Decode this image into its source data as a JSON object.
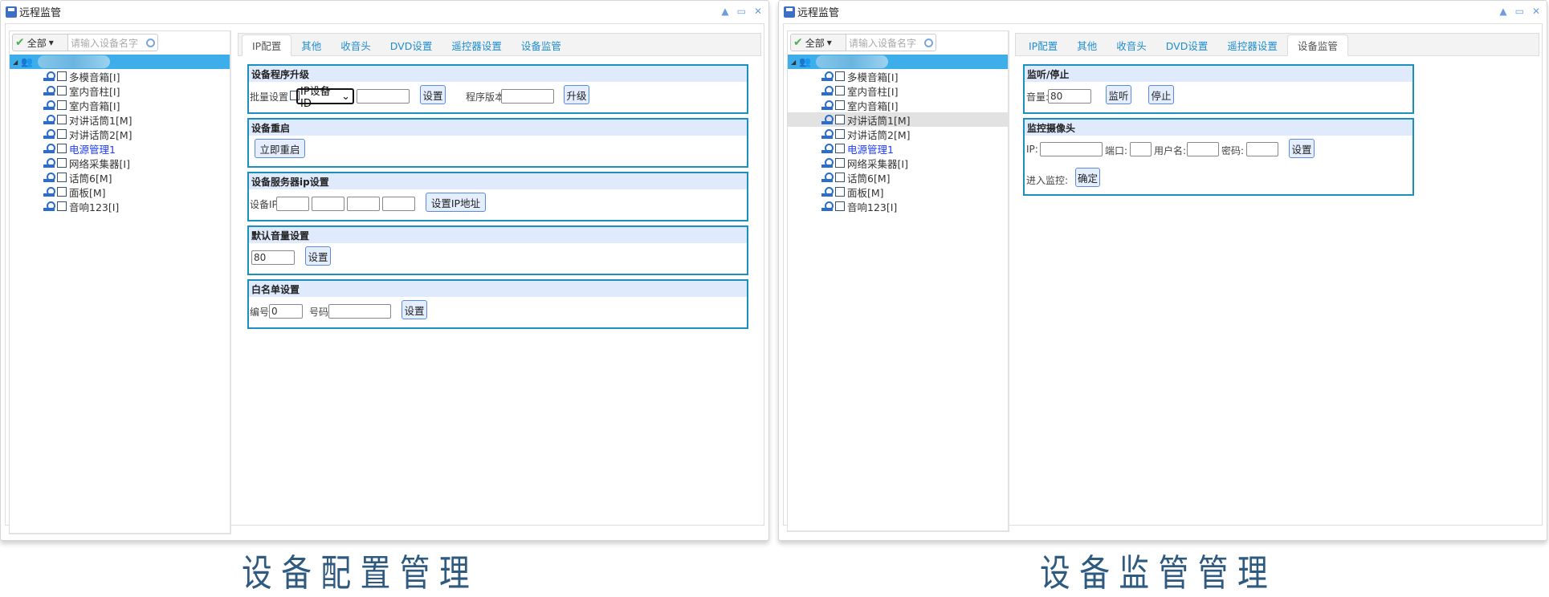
{
  "colors": {
    "accent": "#3daee9",
    "section_border": "#1a8fc0",
    "tab_text": "#1f8ed1",
    "caption": "#2f5a80"
  },
  "window_title": "远程监管",
  "window_buttons": [
    "collapse-icon",
    "maximize-icon",
    "close-icon"
  ],
  "tree": {
    "filter_label": "全部",
    "search_placeholder": "请输入设备名字",
    "items": [
      "多模音箱[I]",
      "室内音柱[I]",
      "室内音箱[I]",
      "对讲话筒1[M]",
      "对讲话筒2[M]",
      "电源管理1",
      "网络采集器[I]",
      "话筒6[M]",
      "面板[M]",
      "音响123[I]"
    ]
  },
  "tabs": [
    "IP配置",
    "其他",
    "收音头",
    "DVD设置",
    "遥控器设置",
    "设备监管"
  ],
  "config_panel": {
    "upgrade": {
      "title": "设备程序升级",
      "batch_label": "批量设置",
      "select_value": "IP设备ID",
      "set_button": "设置",
      "version_label": "程序版本:",
      "upgrade_button": "升级"
    },
    "restart": {
      "title": "设备重启",
      "button": "立即重启"
    },
    "server_ip": {
      "title": "设备服务器ip设置",
      "label": "设备IP:",
      "button": "设置IP地址"
    },
    "volume": {
      "title": "默认音量设置",
      "value": "80",
      "button": "设置"
    },
    "whitelist": {
      "title": "白名单设置",
      "id_label": "编号:",
      "id_value": "0",
      "number_label": "号码:",
      "button": "设置"
    }
  },
  "monitor_panel": {
    "listen": {
      "title": "监听/停止",
      "volume_label": "音量:",
      "volume_value": "80",
      "listen_button": "监听",
      "stop_button": "停止"
    },
    "camera": {
      "title": "监控摄像头",
      "ip_label": "IP:",
      "port_label": "端口:",
      "user_label": "用户名:",
      "password_label": "密码:",
      "set_button": "设置",
      "enter_label": "进入监控:",
      "confirm_button": "确定"
    }
  },
  "captions": {
    "left": "设备配置管理",
    "right": "设备监管管理"
  }
}
